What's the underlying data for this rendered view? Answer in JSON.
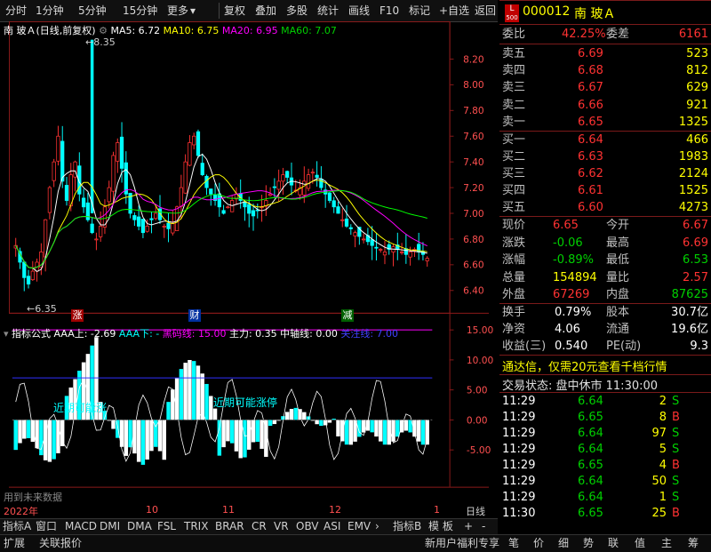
{
  "toolbar": {
    "left": [
      "分时",
      "1分钟",
      "5分钟",
      "15分钟",
      "更多"
    ],
    "right": [
      "复权",
      "叠加",
      "多股",
      "统计",
      "画线",
      "F10",
      "标记",
      "+自选",
      "返回"
    ]
  },
  "chart_header": {
    "stock_name": "南 玻Ａ(日线,前复权)",
    "ma5": "MA5: 6.72",
    "ma10": "MA10: 6.75",
    "ma20": "MA20: 6.95",
    "ma60": "MA60: 7.07"
  },
  "price_axis": [
    "8.20",
    "8.00",
    "7.80",
    "7.60",
    "7.40",
    "7.20",
    "7.00",
    "6.80",
    "6.60",
    "6.40"
  ],
  "price_annotations": {
    "high": "8.35",
    "low": "6.35"
  },
  "event_markers": [
    "涨",
    "财",
    "减"
  ],
  "indicator_header": {
    "name": "指标公式",
    "aaa_up": "AAA上: -2.69",
    "aaa_down": "AAA下: -",
    "black_line": "黑码线: 15.00",
    "main_force": "主力: 0.35",
    "center_line": "中轴线: 0.00",
    "neckline": "关注线: 7.00"
  },
  "indicator_axis": [
    "15.00",
    "10.00",
    "5.00",
    "0.00",
    "-5.00"
  ],
  "indicator_notes": [
    "近期可能涨",
    "近期可能涨停"
  ],
  "indicator_footer": "用到未来数据",
  "date_axis": [
    "2022年",
    "10",
    "11",
    "12",
    "1"
  ],
  "date_axis_right": "日线",
  "tabs": [
    "指标A",
    "窗口",
    "MACD",
    "DMI",
    "DMA",
    "FSL",
    "TRIX",
    "BRAR",
    "CR",
    "VR",
    "OBV",
    "ASI",
    "EMV"
  ],
  "tabs_right": [
    "指标B",
    "模 板",
    "+",
    "-"
  ],
  "status_left": [
    "扩展",
    "关联报价"
  ],
  "status_mid": "新用户福利专享",
  "status_right": [
    "笔",
    "价",
    "细",
    "势",
    "联",
    "值",
    "主",
    "筹"
  ],
  "quote": {
    "code": "000012",
    "name": "南 玻Ａ",
    "badge_top": "L",
    "badge_bottom": "500",
    "webi_label": "委比",
    "webi_value": "42.25%",
    "weicha_label": "委差",
    "weicha_value": "6161",
    "asks": [
      {
        "label": "卖五",
        "price": "6.69",
        "vol": "523"
      },
      {
        "label": "卖四",
        "price": "6.68",
        "vol": "812"
      },
      {
        "label": "卖三",
        "price": "6.67",
        "vol": "629"
      },
      {
        "label": "卖二",
        "price": "6.66",
        "vol": "921"
      },
      {
        "label": "卖一",
        "price": "6.65",
        "vol": "1325"
      }
    ],
    "bids": [
      {
        "label": "买一",
        "price": "6.64",
        "vol": "466"
      },
      {
        "label": "买二",
        "price": "6.63",
        "vol": "1983"
      },
      {
        "label": "买三",
        "price": "6.62",
        "vol": "2124"
      },
      {
        "label": "买四",
        "price": "6.61",
        "vol": "1525"
      },
      {
        "label": "买五",
        "price": "6.60",
        "vol": "4273"
      }
    ],
    "stats": [
      {
        "l1": "现价",
        "v1": "6.65",
        "l2": "今开",
        "v2": "6.67"
      },
      {
        "l1": "涨跌",
        "v1": "-0.06",
        "l2": "最高",
        "v2": "6.69"
      },
      {
        "l1": "涨幅",
        "v1": "-0.89%",
        "l2": "最低",
        "v2": "6.53"
      },
      {
        "l1": "总量",
        "v1": "154894",
        "l2": "量比",
        "v2": "2.57"
      },
      {
        "l1": "外盘",
        "v1": "67269",
        "l2": "内盘",
        "v2": "87625"
      }
    ],
    "stats2": [
      {
        "l1": "换手",
        "v1": "0.79%",
        "l2": "股本",
        "v2": "30.7亿"
      },
      {
        "l1": "净资",
        "v1": "4.06",
        "l2": "流通",
        "v2": "19.6亿"
      },
      {
        "l1": "收益(三)",
        "v1": "0.540",
        "l2": "PE(动)",
        "v2": "9.3"
      }
    ],
    "ad_text": "通达信，仅需20元查看千档行情",
    "trade_status": "交易状态: 盘中休市 11:30:00",
    "ticks": [
      {
        "time": "11:29",
        "price": "6.64",
        "vol": "2",
        "side": "S"
      },
      {
        "time": "11:29",
        "price": "6.65",
        "vol": "8",
        "side": "B"
      },
      {
        "time": "11:29",
        "price": "6.64",
        "vol": "97",
        "side": "S"
      },
      {
        "time": "11:29",
        "price": "6.64",
        "vol": "5",
        "side": "S"
      },
      {
        "time": "11:29",
        "price": "6.65",
        "vol": "4",
        "side": "B"
      },
      {
        "time": "11:29",
        "price": "6.64",
        "vol": "50",
        "side": "S"
      },
      {
        "time": "11:29",
        "price": "6.64",
        "vol": "1",
        "side": "S"
      },
      {
        "time": "11:30",
        "price": "6.65",
        "vol": "25",
        "side": "B"
      }
    ]
  },
  "colors": {
    "up": "#ff3232",
    "down": "#00ffff",
    "ma5": "#ffffff",
    "ma10": "#ffff00",
    "ma20": "#ff00ff",
    "ma60": "#00ff00"
  }
}
